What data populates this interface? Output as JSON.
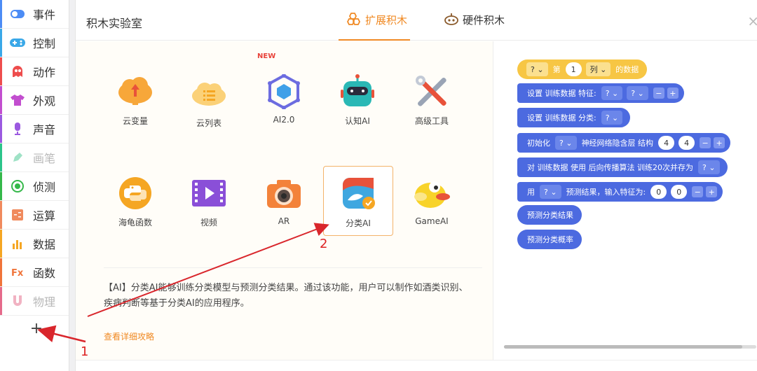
{
  "sidebar": {
    "items": [
      {
        "label": "事件",
        "color": "#4c8cf5",
        "icon": "toggle-icon",
        "dim": false
      },
      {
        "label": "控制",
        "color": "#3aa8e8",
        "icon": "gamepad-icon",
        "dim": false
      },
      {
        "label": "动作",
        "color": "#ee4d4d",
        "icon": "ghost-icon",
        "dim": false
      },
      {
        "label": "外观",
        "color": "#c24ecf",
        "icon": "shirt-icon",
        "dim": false
      },
      {
        "label": "声音",
        "color": "#9b59e0",
        "icon": "microphone-icon",
        "dim": false
      },
      {
        "label": "画笔",
        "color": "#2cc48a",
        "icon": "pen-icon",
        "dim": true
      },
      {
        "label": "侦测",
        "color": "#35b84a",
        "icon": "target-icon",
        "dim": false
      },
      {
        "label": "运算",
        "color": "#f08a5d",
        "icon": "calculator-icon",
        "dim": false
      },
      {
        "label": "数据",
        "color": "#f5a623",
        "icon": "bar-chart-icon",
        "dim": false
      },
      {
        "label": "函数",
        "color": "#f0743a",
        "icon": "function-icon",
        "dim": false
      },
      {
        "label": "物理",
        "color": "#e56a8b",
        "icon": "magnet-icon",
        "dim": true
      }
    ],
    "add_label": "+"
  },
  "dialog": {
    "title": "积木实验室",
    "tabs": [
      {
        "label": "扩展积木",
        "icon": "hexagons-icon",
        "active": true
      },
      {
        "label": "硬件积木",
        "icon": "robot-head-icon",
        "active": false
      }
    ],
    "close_label": "×"
  },
  "extensions": [
    {
      "label": "云变量",
      "icon": "cloud-upload-icon",
      "new": false
    },
    {
      "label": "云列表",
      "icon": "cloud-list-icon",
      "new": false
    },
    {
      "label": "AI2.0",
      "icon": "hexagon-network-icon",
      "new": true,
      "badge": "NEW"
    },
    {
      "label": "认知AI",
      "icon": "robot-icon",
      "new": false
    },
    {
      "label": "高级工具",
      "icon": "tools-icon",
      "new": false
    },
    {
      "label": "海龟函数",
      "icon": "python-icon",
      "new": false
    },
    {
      "label": "视频",
      "icon": "film-icon",
      "new": false
    },
    {
      "label": "AR",
      "icon": "camera-icon",
      "new": false
    },
    {
      "label": "分类AI",
      "icon": "classify-icon",
      "new": false,
      "selected": true
    },
    {
      "label": "GameAI",
      "icon": "bird-icon",
      "new": false
    }
  ],
  "description": "【AI】分类AI能够训练分类模型与预测分类结果。通过该功能，用户可以制作如酒类识别、疾病判断等基于分类AI的应用程序。",
  "more_link": "查看详细攻略",
  "blocks": {
    "b1": {
      "dd1": "?",
      "t1": "第",
      "num": "1",
      "dd2": "列",
      "t2": "的数据"
    },
    "b2": {
      "t1": "设置 训练数据 特征:",
      "dd1": "?",
      "dd2": "?"
    },
    "b3": {
      "t1": "设置 训练数据 分类:",
      "dd1": "?"
    },
    "b4": {
      "t1": "初始化",
      "dd1": "?",
      "t2": "神经网络隐含层 结构",
      "n1": "4",
      "n2": "4"
    },
    "b5": {
      "t1": "对 训练数据 使用 后向传播算法 训练20次并存为",
      "dd1": "?"
    },
    "b6": {
      "t1": "用",
      "dd1": "?",
      "t2": "预测结果，输入特征为:",
      "n1": "0",
      "n2": "0"
    },
    "b7": {
      "t1": "预测分类结果"
    },
    "b8": {
      "t1": "预测分类概率"
    },
    "minus": "−",
    "plus": "+",
    "caret": "⌄"
  },
  "annotations": {
    "a1": "1",
    "a2": "2"
  },
  "colors": {
    "accent": "#f08a24",
    "block_blue": "#4c6ae0",
    "block_yellow": "#f7c644",
    "arrow": "#d9262c"
  }
}
